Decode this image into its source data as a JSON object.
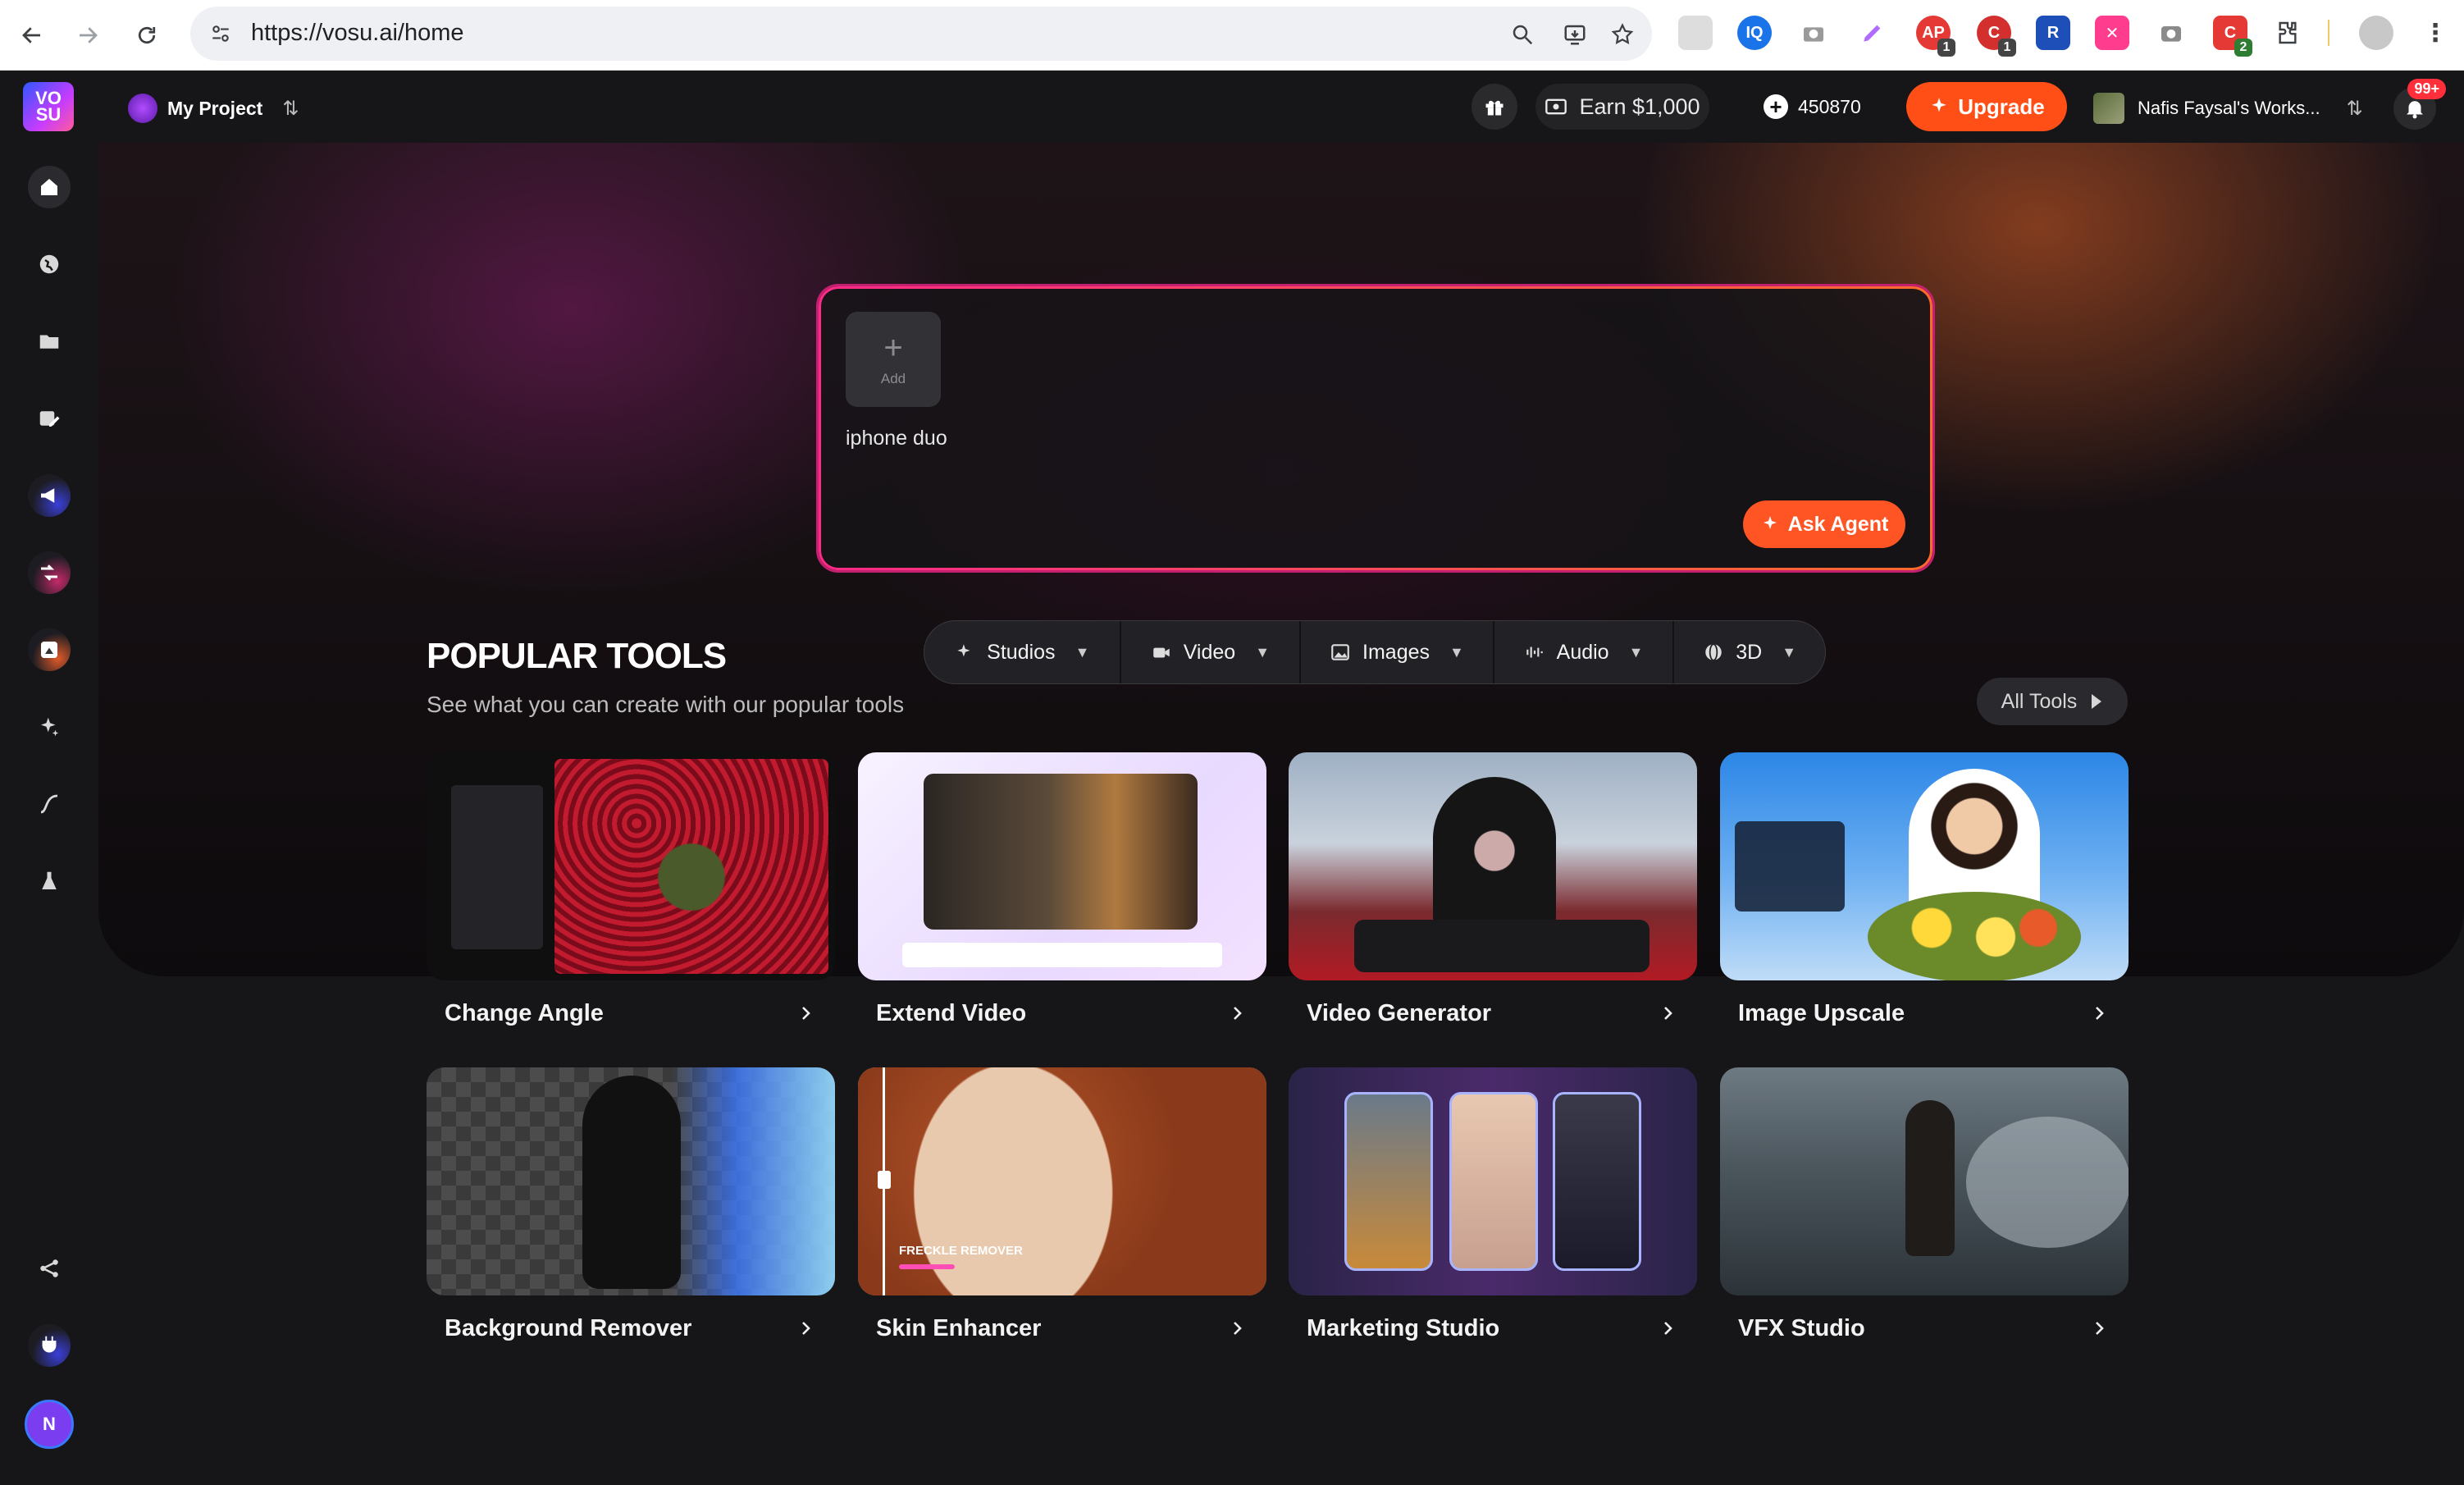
{
  "browser": {
    "url": "https://vosu.ai/home",
    "extensions": [
      {
        "name": "extension-1",
        "badge": ""
      },
      {
        "name": "extension-2",
        "badge": ""
      },
      {
        "name": "camera-extension",
        "badge": ""
      },
      {
        "name": "pen-extension",
        "badge": ""
      },
      {
        "name": "extension-5",
        "badge": "1"
      },
      {
        "name": "extension-6",
        "badge": "1"
      },
      {
        "name": "extension-7",
        "badge": ""
      },
      {
        "name": "extension-8",
        "badge": ""
      },
      {
        "name": "camera-extension-2",
        "badge": ""
      },
      {
        "name": "extension-10",
        "badge": "2"
      }
    ]
  },
  "header": {
    "logo": "VO SU",
    "project_name": "My Project",
    "earn_label": "Earn $1,000",
    "credits": "450870",
    "upgrade_label": "Upgrade",
    "workspace_name": "Nafis Faysal's Works...",
    "notification_count": "99+"
  },
  "sidebar": {
    "items": [
      "home",
      "explore",
      "folder",
      "edit",
      "megaphone",
      "shuffle",
      "sticker",
      "sparkle",
      "curve",
      "lab"
    ],
    "bottom": [
      "share",
      "plug"
    ],
    "avatar_initial": "N"
  },
  "prompt": {
    "add_label": "Add",
    "text": "iphone duo",
    "ask_agent_label": "Ask Agent"
  },
  "categories": [
    {
      "label": "Studios",
      "icon": "sparkle-icon"
    },
    {
      "label": "Video",
      "icon": "video-icon"
    },
    {
      "label": "Images",
      "icon": "image-icon"
    },
    {
      "label": "Audio",
      "icon": "audio-icon"
    },
    {
      "label": "3D",
      "icon": "globe-icon"
    }
  ],
  "popular": {
    "title": "POPULAR TOOLS",
    "subtitle": "See what you can create with our popular tools",
    "all_tools_label": "All Tools",
    "tools": [
      {
        "label": "Change Angle"
      },
      {
        "label": "Extend Video"
      },
      {
        "label": "Video Generator"
      },
      {
        "label": "Image Upscale"
      },
      {
        "label": "Background Remover"
      },
      {
        "label": "Skin Enhancer",
        "overlay": "FRECKLE REMOVER"
      },
      {
        "label": "Marketing Studio"
      },
      {
        "label": "VFX Studio"
      }
    ]
  },
  "colors": {
    "accent_orange": "#ff4f17",
    "background": "#161618",
    "prompt_border_start": "#ff2a88",
    "prompt_border_end": "#ff6a2c"
  }
}
